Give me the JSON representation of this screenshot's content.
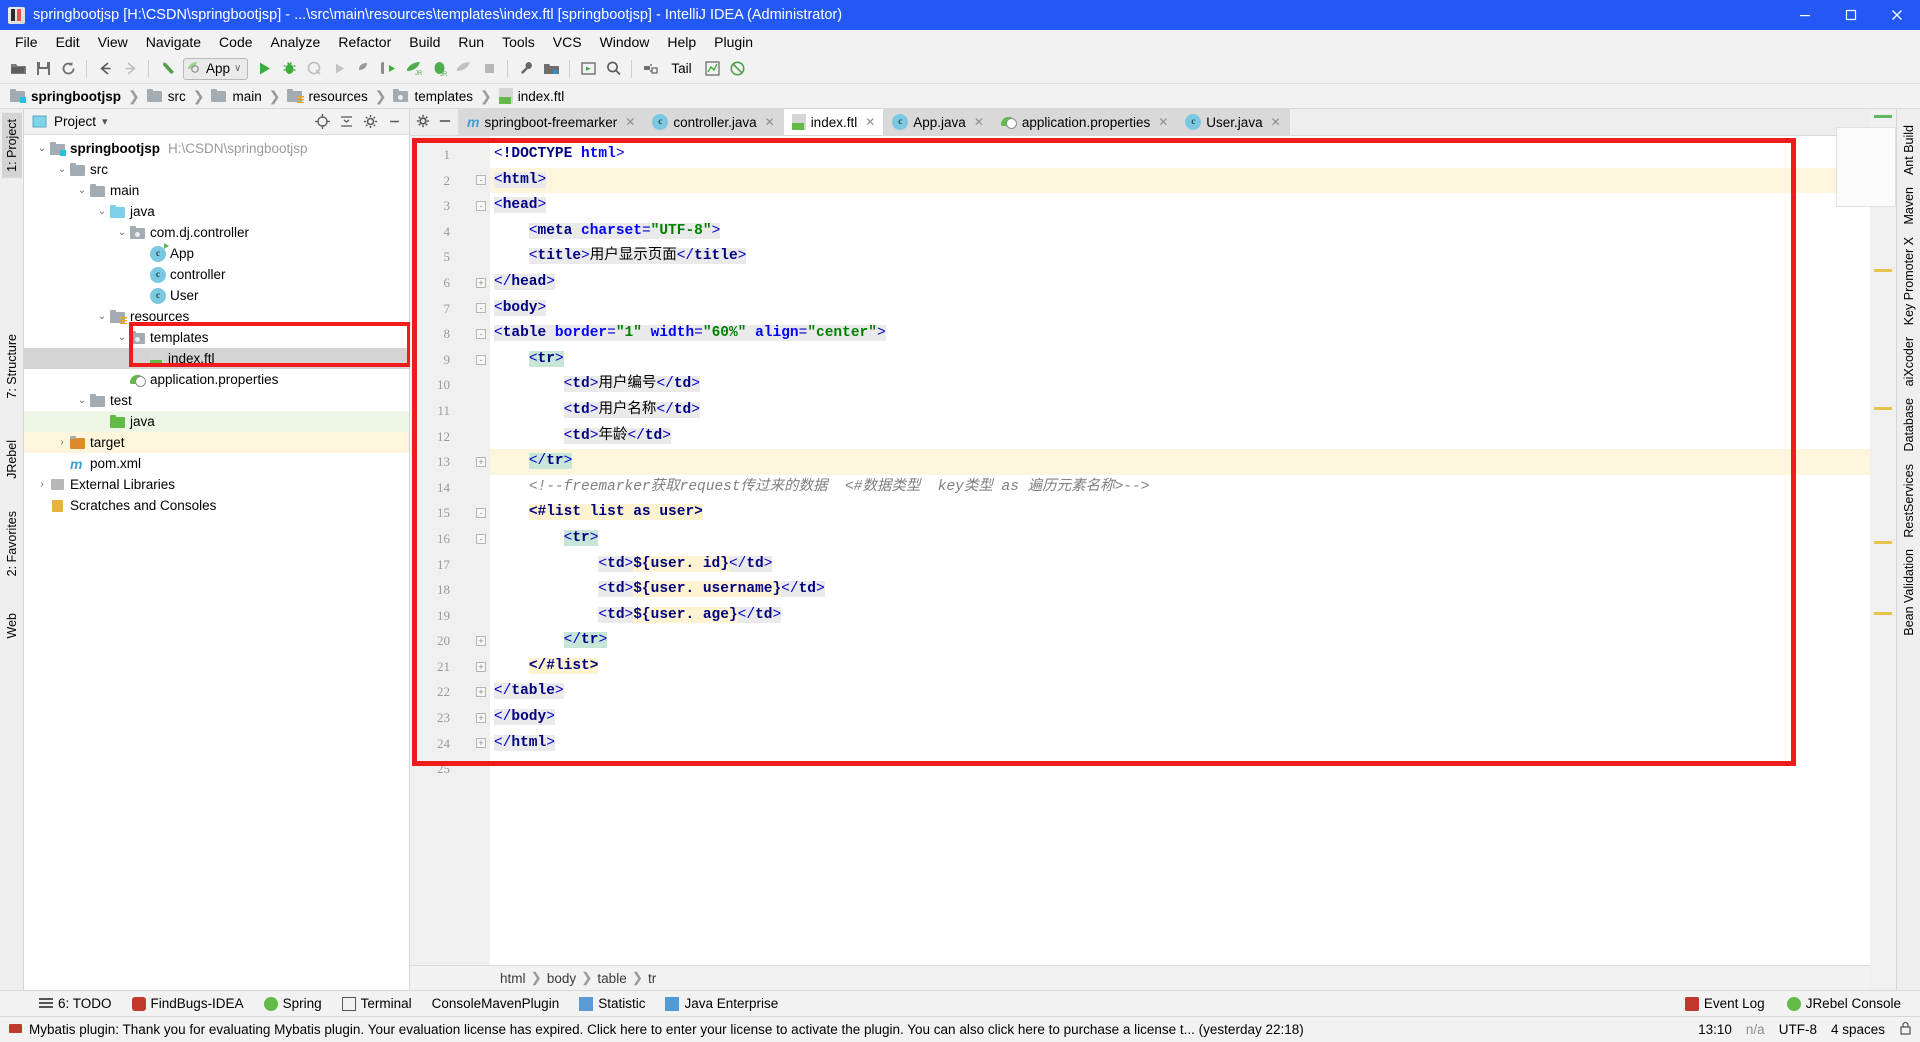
{
  "window": {
    "title": "springbootjsp [H:\\CSDN\\springbootjsp] - ...\\src\\main\\resources\\templates\\index.ftl [springbootjsp] - IntelliJ IDEA (Administrator)",
    "minimize": "–",
    "maximize": "❐",
    "close": "✕"
  },
  "menu": [
    "File",
    "Edit",
    "View",
    "Navigate",
    "Code",
    "Analyze",
    "Refactor",
    "Build",
    "Run",
    "Tools",
    "VCS",
    "Window",
    "Help",
    "Plugin"
  ],
  "toolbar": {
    "open_label": "open-folder-icon",
    "save_label": "save-icon",
    "sync_label": "sync-icon",
    "back_label": "back-arrow-icon",
    "forward_label": "forward-arrow-icon",
    "undo_label": "undo-icon",
    "run_config": "App",
    "run_config_caret": "∨",
    "tail_label": "Tail"
  },
  "breadcrumb": [
    {
      "label": "springbootjsp",
      "bold": true
    },
    {
      "label": "src",
      "bold": false
    },
    {
      "label": "main",
      "bold": false
    },
    {
      "label": "resources",
      "bold": false
    },
    {
      "label": "templates",
      "bold": false
    },
    {
      "label": "index.ftl",
      "bold": false
    }
  ],
  "left_tabs": [
    {
      "label": "1: Project",
      "selected": true
    },
    {
      "label": "7: Structure",
      "selected": false
    },
    {
      "label": "JRebel",
      "selected": false
    },
    {
      "label": "2: Favorites",
      "selected": false
    },
    {
      "label": "Web",
      "selected": false
    }
  ],
  "right_tabs": [
    "Ant Build",
    "Maven",
    "Key Promoter X",
    "aiXcoder",
    "Database",
    "RestServices",
    "Bean Validation"
  ],
  "project_panel": {
    "title": "Project",
    "title_caret": "▾",
    "locate_icon": "crosshair-icon",
    "collapse_icon": "collapse-all-icon",
    "settings_icon": "gear-icon",
    "hide_icon": "hide-icon",
    "tree": [
      {
        "indent": 0,
        "arrow": "⌄",
        "icon": "folder-module",
        "label": "springbootjsp",
        "bold": true,
        "path": "H:\\CSDN\\springbootjsp",
        "state": ""
      },
      {
        "indent": 1,
        "arrow": "⌄",
        "icon": "folder-grey",
        "label": "src",
        "bold": false,
        "path": "",
        "state": ""
      },
      {
        "indent": 2,
        "arrow": "⌄",
        "icon": "folder-grey",
        "label": "main",
        "bold": false,
        "path": "",
        "state": ""
      },
      {
        "indent": 3,
        "arrow": "⌄",
        "icon": "folder-blue",
        "label": "java",
        "bold": false,
        "path": "",
        "state": ""
      },
      {
        "indent": 4,
        "arrow": "⌄",
        "icon": "folder-pkg",
        "label": "com.dj.controller",
        "bold": false,
        "path": "",
        "state": ""
      },
      {
        "indent": 5,
        "arrow": "",
        "icon": "class-run",
        "label": "App",
        "bold": false,
        "path": "",
        "state": ""
      },
      {
        "indent": 5,
        "arrow": "",
        "icon": "class",
        "label": "controller",
        "bold": false,
        "path": "",
        "state": ""
      },
      {
        "indent": 5,
        "arrow": "",
        "icon": "class",
        "label": "User",
        "bold": false,
        "path": "",
        "state": ""
      },
      {
        "indent": 3,
        "arrow": "⌄",
        "icon": "folder-res",
        "label": "resources",
        "bold": false,
        "path": "",
        "state": ""
      },
      {
        "indent": 4,
        "arrow": "⌄",
        "icon": "folder-pkg",
        "label": "templates",
        "bold": false,
        "path": "",
        "state": ""
      },
      {
        "indent": 5,
        "arrow": "",
        "icon": "ftl-file",
        "label": "index.ftl",
        "bold": false,
        "path": "",
        "state": "selected"
      },
      {
        "indent": 4,
        "arrow": "",
        "icon": "spring-leaf",
        "label": "application.properties",
        "bold": false,
        "path": "",
        "state": ""
      },
      {
        "indent": 2,
        "arrow": "⌄",
        "icon": "folder-grey",
        "label": "test",
        "bold": false,
        "path": "",
        "state": ""
      },
      {
        "indent": 3,
        "arrow": "",
        "icon": "folder-green",
        "label": "java",
        "bold": false,
        "path": "",
        "state": "green"
      },
      {
        "indent": 1,
        "arrow": "›",
        "icon": "folder-target",
        "label": "target",
        "bold": false,
        "path": "",
        "state": "yellow"
      },
      {
        "indent": 1,
        "arrow": "",
        "icon": "maven-file",
        "label": "pom.xml",
        "bold": false,
        "path": "",
        "state": ""
      },
      {
        "indent": 0,
        "arrow": "›",
        "icon": "lib",
        "label": "External Libraries",
        "bold": false,
        "path": "",
        "state": ""
      },
      {
        "indent": 0,
        "arrow": "",
        "icon": "scratch",
        "label": "Scratches and Consoles",
        "bold": false,
        "path": "",
        "state": ""
      }
    ]
  },
  "editor": {
    "tabs": [
      {
        "label": "springboot-freemarker",
        "icon": "maven-module-icon",
        "active": false,
        "closable": true
      },
      {
        "label": "controller.java",
        "icon": "java-class-icon",
        "active": false,
        "closable": true
      },
      {
        "label": "index.ftl",
        "icon": "ftl-file-icon",
        "active": true,
        "closable": true
      },
      {
        "label": "App.java",
        "icon": "java-run-icon",
        "active": false,
        "closable": true
      },
      {
        "label": "application.properties",
        "icon": "spring-leaf-icon",
        "active": false,
        "closable": true
      },
      {
        "label": "User.java",
        "icon": "java-class-icon",
        "active": false,
        "closable": true
      }
    ],
    "line_numbers": [
      1,
      2,
      3,
      4,
      5,
      6,
      7,
      8,
      9,
      10,
      11,
      12,
      13,
      14,
      15,
      16,
      17,
      18,
      19,
      20,
      21,
      22,
      23,
      24,
      25
    ],
    "lines": [
      "<!DOCTYPE html>",
      "<html>",
      "<head>",
      "    <meta charset=\"UTF-8\">",
      "    <title>用户显示页面</title>",
      "</head>",
      "<body>",
      "<table border=\"1\" width=\"60%\" align=\"center\">",
      "    <tr>",
      "        <td>用户编号</td>",
      "        <td>用户名称</td>",
      "        <td>年龄</td>",
      "    </tr>",
      "    <!--freemarker获取request传过来的数据  <#数据类型  key类型 as 遍历元素名称>-->",
      "    <#list list as user>",
      "        <tr>",
      "            <td>${user. id}</td>",
      "            <td>${user. username}</td>",
      "            <td>${user. age}</td>",
      "        </tr>",
      "    </#list>",
      "</table>",
      "</body>",
      "</html>",
      ""
    ],
    "breadcrumb": [
      "html",
      "body",
      "table",
      "tr"
    ],
    "breadcrumb_sep": "›"
  },
  "bottom_tools": [
    {
      "label": "6: TODO",
      "icon": "todo-icon"
    },
    {
      "label": "FindBugs-IDEA",
      "icon": "bug-icon"
    },
    {
      "label": "Spring",
      "icon": "spring-icon"
    },
    {
      "label": "Terminal",
      "icon": "terminal-icon"
    },
    {
      "label": "ConsoleMavenPlugin",
      "icon": "maven-icon"
    },
    {
      "label": "Statistic",
      "icon": "statistic-icon"
    },
    {
      "label": "Java Enterprise",
      "icon": "java-enterprise-icon"
    }
  ],
  "bottom_right": [
    {
      "label": "Event Log",
      "icon": "event-log-icon"
    },
    {
      "label": "JRebel Console",
      "icon": "jrebel-icon"
    }
  ],
  "status_bar": {
    "message": "Mybatis plugin: Thank you for evaluating Mybatis plugin. Your evaluation license has expired. Click here to enter your license to activate the plugin. You can also click here to purchase a license t... (yesterday 22:18)",
    "time": "13:10",
    "na": "n/a",
    "encoding": "UTF-8",
    "encoding_caret": "↕",
    "indent": "4 spaces",
    "lock_icon": "lock-icon"
  },
  "colors": {
    "title_blue": "#2458f5",
    "annotation_red": "#f01b1b",
    "selection_grey": "#d4d4d4",
    "tag_navy": "#000080",
    "string_green": "#008000",
    "attr_blue": "#0000ff",
    "comment_grey": "#808080"
  }
}
